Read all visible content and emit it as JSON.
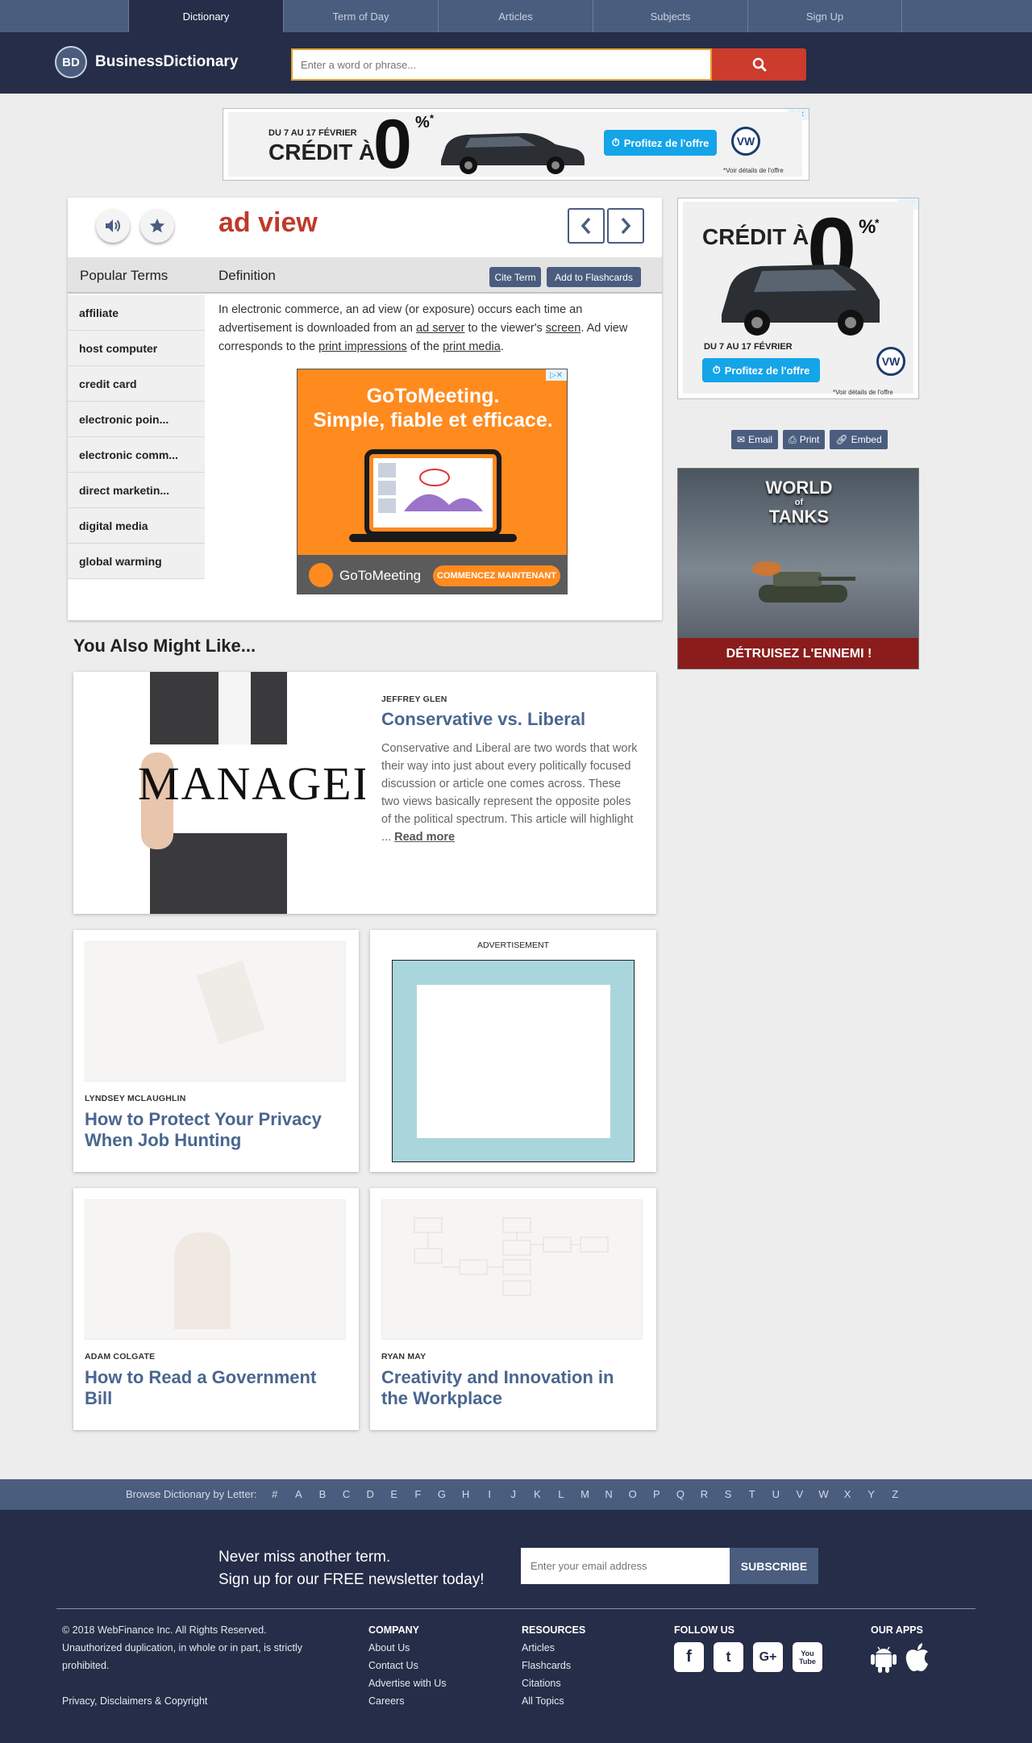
{
  "nav": {
    "tabs": [
      {
        "label": "Dictionary"
      },
      {
        "label": "Term of Day"
      },
      {
        "label": "Articles"
      },
      {
        "label": "Subjects"
      },
      {
        "label": "Sign Up"
      }
    ]
  },
  "header": {
    "logo_badge": "BD",
    "logo_text": "BusinessDictionary",
    "search_placeholder": "Enter a word or phrase..."
  },
  "top_ad": {
    "dates": "DU 7 AU 17 FÉVRIER",
    "headline": "CRÉDIT À",
    "big_zero": "0",
    "percent": "%",
    "asterisk": "*",
    "offer": "Profitez de l'offre",
    "brand": "VW",
    "fine_print": "*Voir détails de l'offre"
  },
  "definition": {
    "term": "ad view",
    "popular_label": "Popular Terms",
    "definition_label": "Definition",
    "cite_button": "Cite Term",
    "flashcard_button": "Add to Flashcards",
    "text_1": "In electronic commerce, an ad view (or exposure) occurs each time an advertisement is downloaded from an ",
    "link_1": "ad server",
    "text_2": " to the viewer's ",
    "link_2": "screen",
    "text_3": ". Ad view corresponds to the ",
    "link_3": "print impressions",
    "text_4": " of the ",
    "link_4": "print media",
    "text_5": "."
  },
  "popular_terms": [
    "affiliate",
    "host computer",
    "credit card",
    "electronic poin...",
    "electronic comm...",
    "direct marketin...",
    "digital media",
    "global warming"
  ],
  "gtm_ad": {
    "line1": "GoToMeeting.",
    "line2": "Simple, fiable et efficace.",
    "brand": "GoToMeeting",
    "cta": "COMMENCEZ MAINTENANT"
  },
  "right_ad1": {
    "headline": "CRÉDIT À",
    "big_zero": "0",
    "percent": "%",
    "asterisk": "*",
    "dates": "DU 7 AU 17 FÉVRIER",
    "offer": "Profitez de l'offre",
    "brand": "VW",
    "fine_print": "*Voir détails de l'offre"
  },
  "share": {
    "email": "Email",
    "print": "Print",
    "embed": "Embed"
  },
  "right_ad2": {
    "logo_line1": "WORLD",
    "logo_of": "of",
    "logo_line2": "TANKS",
    "cta": "DÉTRUISEZ L'ENNEMI !"
  },
  "might_like": {
    "title": "You Also Might Like...",
    "featured": {
      "image_word": "MANAGEI",
      "author": "JEFFREY GLEN",
      "title": "Conservative vs. Liberal",
      "excerpt": "Conservative and Liberal are two words that work their way into just about every politically focused discussion or article one comes across. These two views basically represent the opposite poles of the political spectrum. This article will highlight ... ",
      "read_more": "Read more"
    },
    "ad_label": "ADVERTISEMENT",
    "cards": [
      {
        "author": "LYNDSEY MCLAUGHLIN",
        "title": "How to Protect Your Privacy When Job Hunting"
      },
      {
        "author": "ADAM COLGATE",
        "title": "How to Read a Government Bill"
      },
      {
        "author": "RYAN MAY",
        "title": "Creativity and Innovation in the Workplace"
      }
    ]
  },
  "browse": {
    "label": "Browse Dictionary by Letter:",
    "letters": [
      "#",
      "A",
      "B",
      "C",
      "D",
      "E",
      "F",
      "G",
      "H",
      "I",
      "J",
      "K",
      "L",
      "M",
      "N",
      "O",
      "P",
      "Q",
      "R",
      "S",
      "T",
      "U",
      "V",
      "W",
      "X",
      "Y",
      "Z"
    ]
  },
  "newsletter": {
    "line1": "Never miss another term.",
    "line2": "Sign up for our FREE newsletter today!",
    "placeholder": "Enter your email address",
    "button": "SUBSCRIBE"
  },
  "footer": {
    "copyright": "© 2018 WebFinance Inc. All Rights Reserved.",
    "unauthorized": "Unauthorized duplication, in whole or in part, is strictly prohibited.",
    "privacy": "Privacy, Disclaimers & Copyright",
    "company": {
      "heading": "COMPANY",
      "links": [
        "About Us",
        "Contact Us",
        "Advertise with Us",
        "Careers"
      ]
    },
    "resources": {
      "heading": "RESOURCES",
      "links": [
        "Articles",
        "Flashcards",
        "Citations",
        "All Topics"
      ]
    },
    "follow": {
      "heading": "FOLLOW US",
      "icons": [
        "f",
        "t",
        "G+",
        "You Tube"
      ]
    },
    "apps": {
      "heading": "OUR APPS"
    }
  },
  "colors": {
    "nav": "#4a5d7e",
    "header": "#252d48",
    "accent_red": "#cc3b2b",
    "term_red": "#c0392b",
    "link_blue": "#4a6690"
  }
}
